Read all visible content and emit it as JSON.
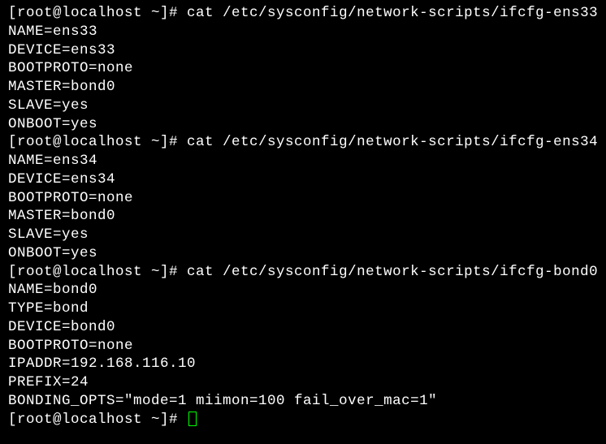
{
  "lines": [
    "[root@localhost ~]# cat /etc/sysconfig/network-scripts/ifcfg-ens33",
    "NAME=ens33",
    "DEVICE=ens33",
    "BOOTPROTO=none",
    "MASTER=bond0",
    "SLAVE=yes",
    "ONBOOT=yes",
    "[root@localhost ~]# cat /etc/sysconfig/network-scripts/ifcfg-ens34",
    "NAME=ens34",
    "DEVICE=ens34",
    "BOOTPROTO=none",
    "MASTER=bond0",
    "SLAVE=yes",
    "ONBOOT=yes",
    "[root@localhost ~]# cat /etc/sysconfig/network-scripts/ifcfg-bond0",
    "NAME=bond0",
    "TYPE=bond",
    "DEVICE=bond0",
    "BOOTPROTO=none",
    "IPADDR=192.168.116.10",
    "PREFIX=24",
    "BONDING_OPTS=\"mode=1 miimon=100 fail_over_mac=1\"",
    "[root@localhost ~]# "
  ]
}
